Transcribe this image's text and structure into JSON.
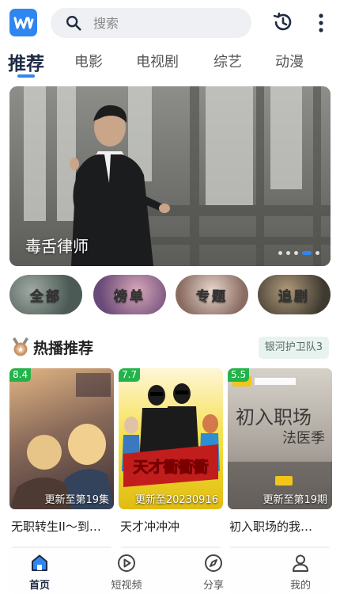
{
  "search": {
    "placeholder": "搜索"
  },
  "tabs": [
    {
      "label": "推荐",
      "active": true
    },
    {
      "label": "电影"
    },
    {
      "label": "电视剧"
    },
    {
      "label": "综艺"
    },
    {
      "label": "动漫"
    }
  ],
  "banner": {
    "title": "毒舌律师",
    "slides": 5,
    "current": 4
  },
  "categories": [
    {
      "label": "全部"
    },
    {
      "label": "榜单"
    },
    {
      "label": "专题"
    },
    {
      "label": "追剧"
    }
  ],
  "hot": {
    "title": "热播推荐",
    "tag": "银河护卫队3",
    "cards": [
      {
        "score": "8.4",
        "update": "更新至第19集",
        "title": "无职转生II～到…"
      },
      {
        "score": "7.7",
        "update": "更新至20230916",
        "title": "天才冲冲冲"
      },
      {
        "score": "5.5",
        "update": "更新至第19期",
        "title": "初入职场的我…"
      }
    ]
  },
  "nav": [
    {
      "label": "首页",
      "icon": "home-icon",
      "active": true
    },
    {
      "label": "短视频",
      "icon": "play-circle-icon"
    },
    {
      "label": "分享",
      "icon": "compass-icon"
    },
    {
      "label": "我的",
      "icon": "user-icon"
    }
  ],
  "colors": {
    "accent": "#2f86f0",
    "score": "#24b34a"
  }
}
